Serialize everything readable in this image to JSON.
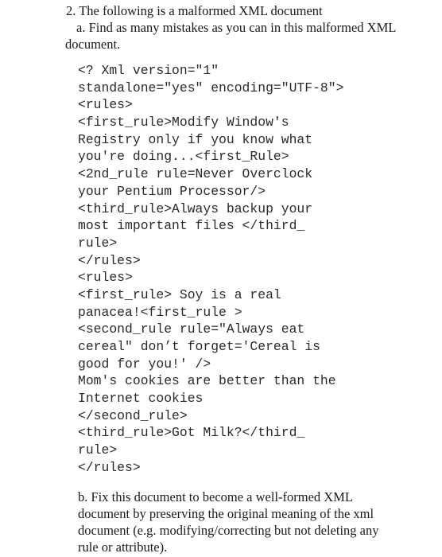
{
  "question": {
    "title": "2. The following is a malformed XML document",
    "part_a": "a. Find as many mistakes as you can in this malformed XML document.",
    "code_lines": [
      "<? Xml version=\"1\"",
      "standalone=\"yes\" encoding=\"UTF-8\">",
      "<rules>",
      "<first_rule>Modify Window's",
      "Registry only if you know what",
      "you're doing...<first_Rule>",
      "<2nd_rule rule=Never Overclock",
      "your Pentium Processor/>",
      "<third_rule>Always backup your",
      "most important files </third_",
      "rule>",
      "</rules>",
      "<rules>",
      "<first_rule> Soy is a real",
      "panacea!<first_rule >",
      "<second_rule rule=\"Always eat",
      "cereal\" don’t forget='Cereal is",
      "good for you!' />",
      "Mom's cookies are better than the",
      "Internet cookies",
      "</second_rule>",
      "<third_rule>Got Milk?</third_",
      "rule>",
      "</rules>"
    ],
    "part_b": "b. Fix this document to become a well-formed XML document by preserving the original meaning of the xml document (e.g. modifying/correcting but not deleting any rule or attribute)."
  }
}
